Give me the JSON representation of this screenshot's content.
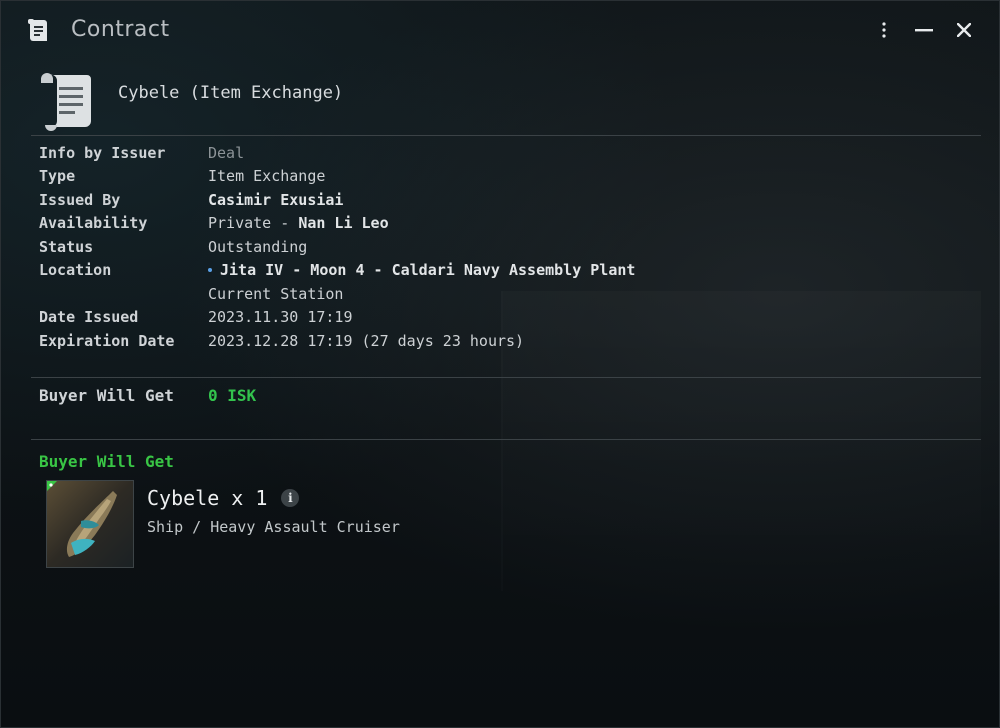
{
  "window": {
    "title": "Contract"
  },
  "header": {
    "contract_name": "Cybele  (Item Exchange)"
  },
  "info": [
    {
      "label": "Info by Issuer",
      "value": "Deal",
      "style": "muted"
    },
    {
      "label": "Type",
      "value": "Item Exchange",
      "style": "normal"
    },
    {
      "label": "Issued By",
      "value": "Casimir Exusiai",
      "style": "bold"
    },
    {
      "label": "Availability",
      "value_prefix": "Private - ",
      "value": "Nan Li Leo",
      "style": "mixed"
    },
    {
      "label": "Status",
      "value": "Outstanding",
      "style": "normal"
    },
    {
      "label": "Location",
      "value": "Jita IV - Moon 4 - Caldari Navy Assembly Plant",
      "style": "bold-link"
    },
    {
      "label": "",
      "value": "Current Station",
      "style": "normal"
    },
    {
      "label": "Date Issued",
      "value": "2023.11.30 17:19",
      "style": "normal"
    },
    {
      "label": "Expiration Date",
      "value": "2023.12.28 17:19 (27 days 23 hours)",
      "style": "normal"
    }
  ],
  "isk": {
    "label": "Buyer Will Get",
    "value": "0 ISK"
  },
  "items_section": {
    "heading": "Buyer Will Get",
    "items": [
      {
        "name": "Cybele x 1",
        "type": "Ship / Heavy Assault Cruiser",
        "icon": "ship-thumbnail"
      }
    ]
  },
  "colors": {
    "accent_green": "#33c24d",
    "location_dot": "#5aa0e6"
  }
}
